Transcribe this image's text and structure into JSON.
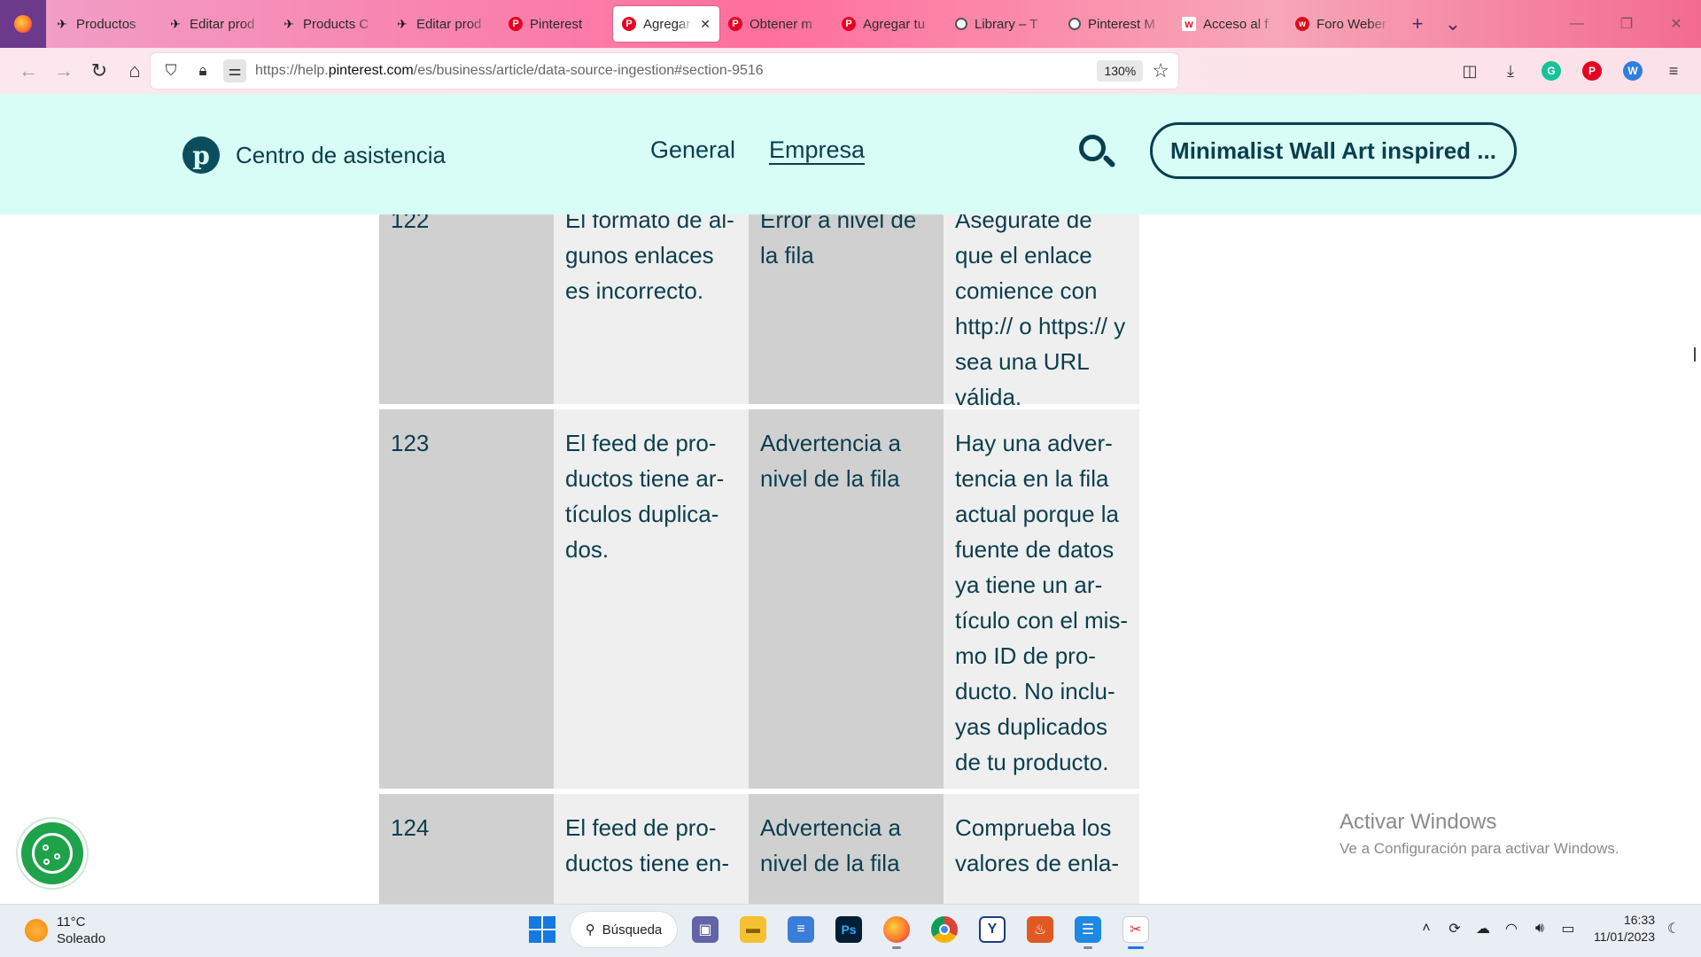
{
  "browser": {
    "tabs": [
      {
        "label": "Productos",
        "icon": "bird-icon"
      },
      {
        "label": "Editar prod",
        "icon": "bird-icon"
      },
      {
        "label": "Products C",
        "icon": "bird-icon"
      },
      {
        "label": "Editar prod",
        "icon": "bird-icon"
      },
      {
        "label": "Pinterest",
        "icon": "pinterest-icon"
      },
      {
        "label": "Agregar",
        "icon": "pinterest-icon",
        "active": true
      },
      {
        "label": "Obtener m",
        "icon": "pinterest-icon"
      },
      {
        "label": "Agregar tu",
        "icon": "pinterest-icon"
      },
      {
        "label": "Library – T",
        "icon": "library-icon"
      },
      {
        "label": "Pinterest M",
        "icon": "library-icon"
      },
      {
        "label": "Acceso al f",
        "icon": "w-icon"
      },
      {
        "label": "Foro Weber",
        "icon": "weber-icon"
      }
    ],
    "url_prefix": "https://help.",
    "url_domain": "pinterest.com",
    "url_path": "/es/business/article/data-source-ingestion#section-9516",
    "zoom": "130%"
  },
  "site": {
    "brand": "Centro de asistencia",
    "nav": {
      "general": "General",
      "empresa": "Empresa"
    },
    "cta": "Minimalist Wall Art inspired ..."
  },
  "table": {
    "rows": [
      {
        "code": "122",
        "message": "El formato de al­gunos enlaces es incorrecto.",
        "level": "Error a nivel de la fila",
        "fix": "Asegúrate de que el enlace comience con http:// o https:// y sea una URL válida."
      },
      {
        "code": "123",
        "message": "El feed de pro­ductos tiene ar­tículos duplica­dos.",
        "level": "Advertencia a nivel de la fila",
        "fix": "Hay una adver­tencia en la fila actual porque la fuente de datos ya tiene un ar­tículo con el mis­mo ID de pro­ducto. No inclu­yas duplicados de tu producto."
      },
      {
        "code": "124",
        "message": "El feed de pro­ductos tiene en-",
        "level": "Advertencia a nivel de la fila",
        "fix": "Comprueba los valores de enla-"
      }
    ]
  },
  "watermark": {
    "title": "Activar Windows",
    "subtitle": "Ve a Configuración para activar Windows."
  },
  "taskbar": {
    "weather_temp": "11°C",
    "weather_desc": "Soleado",
    "search_label": "Búsqueda",
    "time": "16:33",
    "date": "11/01/2023"
  },
  "colors": {
    "header_bg": "#d7fdf6",
    "brand_text": "#0b3e4d",
    "cell_dark": "#d0d0d0",
    "cell_light": "#efefef",
    "pinterest_red": "#e60023"
  }
}
